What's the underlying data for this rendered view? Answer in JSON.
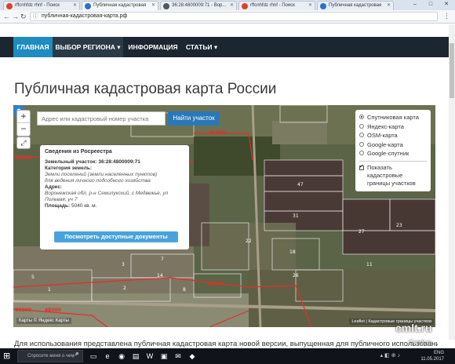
{
  "browser": {
    "tabs": [
      {
        "label": "rffcnhfdz rhnf - Поиск",
        "active": false,
        "favicon_color": "#e0402a"
      },
      {
        "label": "Публичная кадастровая",
        "active": true,
        "favicon_color": "#2e6fd0"
      },
      {
        "label": "36:28:4800009:71 - Вор...",
        "active": false,
        "favicon_color": "#555555"
      },
      {
        "label": "rffcnhfdz rhnf - Поиск",
        "active": false,
        "favicon_color": "#e0402a"
      },
      {
        "label": "Публичная кадастровая",
        "active": false,
        "favicon_color": "#2e6fd0"
      }
    ],
    "url": "публичная-кадастровая-карта.рф",
    "window_controls": [
      "–",
      "□",
      "✕"
    ]
  },
  "nav": {
    "items": [
      {
        "label": "ГЛАВНАЯ"
      },
      {
        "label": "ВЫБОР РЕГИОНА ▾"
      },
      {
        "label": "ИНФОРМАЦИЯ"
      },
      {
        "label": "СТАТЬИ ▾"
      }
    ]
  },
  "page": {
    "title": "Публичная кадастровая карта России",
    "intro": "Для использования представлена публичная кадастровая карта новой версии, выпущенная для публичного использования"
  },
  "map": {
    "zoom_in": "+",
    "zoom_out": "−",
    "fullscreen": "⤢",
    "search_placeholder": "Адрес или кадастровый номер участка",
    "find_button": "Найти участок",
    "layers": [
      {
        "label": "Спутниковая карта",
        "selected": true
      },
      {
        "label": "Яндекс-карта",
        "selected": false
      },
      {
        "label": "OSM-карта",
        "selected": false
      },
      {
        "label": "Google-карта",
        "selected": false
      },
      {
        "label": "Google-спутник",
        "selected": false
      }
    ],
    "boundary_checkbox": {
      "label_1": "Показать",
      "label_2": "кадастровые",
      "label_3": "границы участков",
      "checked": true
    },
    "popup": {
      "heading": "Сведения из Росреестра",
      "parcel_label": "Земельный участок:",
      "parcel_value": "36:28:4800009:71",
      "category_label": "Категория земель:",
      "category_value_1": "Земли поселений (земли населенных пунктов)",
      "category_value_2": "для ведения личного подсобного хозяйства",
      "address_label": "Адрес:",
      "address_value_1": "Воронежская обл, р-н Семилукский, с Медвежье, ул",
      "address_value_2": "Полевая, уч 7",
      "area_label": "Площадь:",
      "area_value": "5040 кв. м.",
      "docs_button": "Посмотреть доступные документы"
    },
    "parcel_numbers": [
      "47",
      "31",
      "23",
      "27",
      "22",
      "11",
      "18",
      "14",
      "3",
      "5",
      "1",
      "26",
      "7",
      "8",
      "2"
    ],
    "red_labels": [
      "48000",
      "48000",
      "48000",
      "48000",
      "48000"
    ],
    "attribution": "Leaflet | Кадастровые границы участков",
    "ya_logo": "Карты © Яндекс Карты"
  },
  "watermark": {
    "main": "cmlt.ru",
    "sub": "Ccmlt.ru"
  },
  "taskbar": {
    "search_text": "Спросите меня о чем-нибудь",
    "tray_time": "11.05.2017",
    "tray_lang": "ENG"
  }
}
